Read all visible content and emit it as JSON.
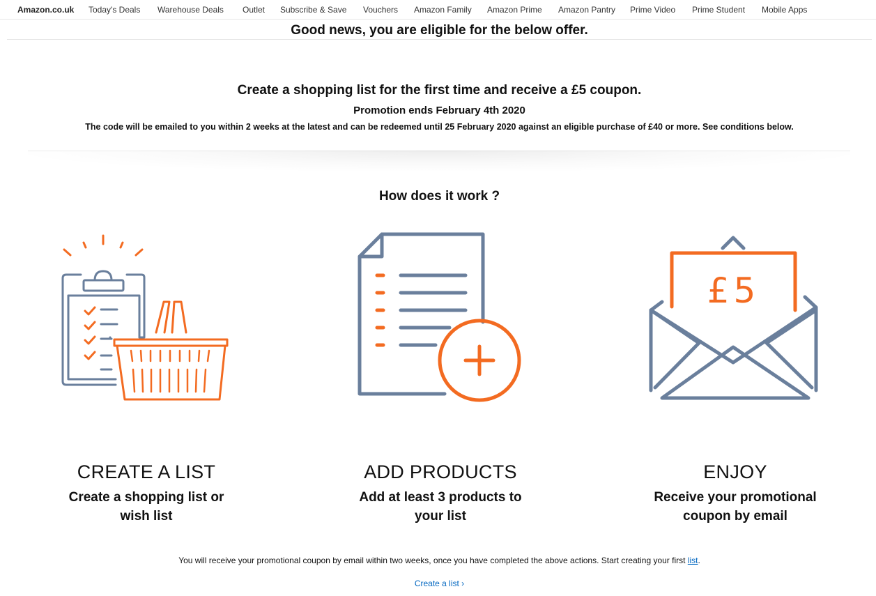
{
  "nav": {
    "items": [
      "Amazon.co.uk",
      "Today's Deals",
      "Warehouse Deals",
      "Outlet",
      "Subscribe & Save",
      "Vouchers",
      "Amazon Family",
      "Amazon Prime",
      "Amazon Pantry",
      "Prime Video",
      "Prime Student",
      "Mobile Apps"
    ]
  },
  "banner": {
    "eligible": "Good news, you are eligible for the below offer."
  },
  "offer": {
    "headline": "Create a shopping list for the first time and receive a £5 coupon.",
    "ends": "Promotion ends February 4th 2020",
    "code_info": "The code will be emailed to you within 2 weeks at the latest and can be redeemed until 25 February 2020 against an eligible purchase of £40 or more. See conditions below."
  },
  "how": {
    "heading": "How does it work ?",
    "steps": [
      {
        "title": "CREATE A LIST",
        "desc_line1": "Create a shopping list or",
        "desc_line2": "wish list",
        "icon": "clipboard-basket-icon"
      },
      {
        "title": "ADD PRODUCTS",
        "desc_line1": "Add at least 3 products to",
        "desc_line2": "your list",
        "icon": "document-add-icon"
      },
      {
        "title": "ENJOY",
        "desc_line1": "Receive your promotional",
        "desc_line2": "coupon by email",
        "icon": "envelope-coupon-icon"
      }
    ],
    "coupon_text": "£5"
  },
  "footer": {
    "note": "You will receive your promotional coupon by email within two weeks, once you have completed the above actions. Start creating your first ",
    "note_link": "list",
    "note_end": ".",
    "cta": "Create a list ›"
  },
  "colors": {
    "blue_grey": "#6a7f9c",
    "orange": "#f36b21",
    "link": "#0066c0"
  }
}
